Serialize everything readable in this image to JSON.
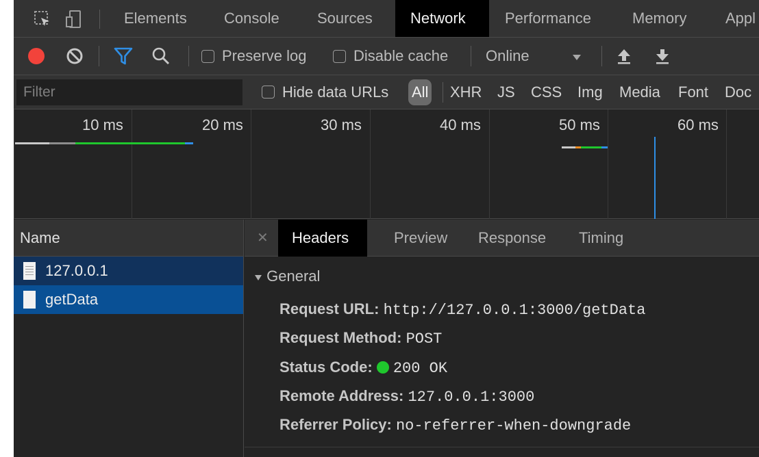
{
  "tabs": [
    {
      "label": "Elements"
    },
    {
      "label": "Console"
    },
    {
      "label": "Sources"
    },
    {
      "label": "Network"
    },
    {
      "label": "Performance"
    },
    {
      "label": "Memory"
    },
    {
      "label": "Appl"
    }
  ],
  "active_tab": "Network",
  "toolbar": {
    "preserve_log": "Preserve log",
    "disable_cache": "Disable cache",
    "throttle": "Online"
  },
  "filter": {
    "placeholder": "Filter",
    "hide_data_urls": "Hide data URLs",
    "types": [
      "All",
      "XHR",
      "JS",
      "CSS",
      "Img",
      "Media",
      "Font",
      "Doc"
    ]
  },
  "overview": {
    "ticks": [
      "10 ms",
      "20 ms",
      "30 ms",
      "40 ms",
      "50 ms",
      "60 ms"
    ]
  },
  "requests": {
    "header": "Name",
    "items": [
      {
        "name": "127.0.0.1"
      },
      {
        "name": "getData"
      }
    ]
  },
  "details": {
    "tabs": [
      "Headers",
      "Preview",
      "Response",
      "Timing"
    ],
    "active_tab": "Headers",
    "section": "General",
    "general": {
      "request_url_key": "Request URL:",
      "request_url": "http://127.0.0.1:3000/getData",
      "request_method_key": "Request Method:",
      "request_method": "POST",
      "status_code_key": "Status Code:",
      "status_code": "200 OK",
      "remote_address_key": "Remote Address:",
      "remote_address": "127.0.0.1:3000",
      "referrer_policy_key": "Referrer Policy:",
      "referrer_policy": "no-referrer-when-downgrade"
    }
  },
  "colors": {
    "record": "#f2433b",
    "filter_active": "#2f8fe6",
    "status_ok": "#1fc72d",
    "selected_row": "#095095"
  }
}
